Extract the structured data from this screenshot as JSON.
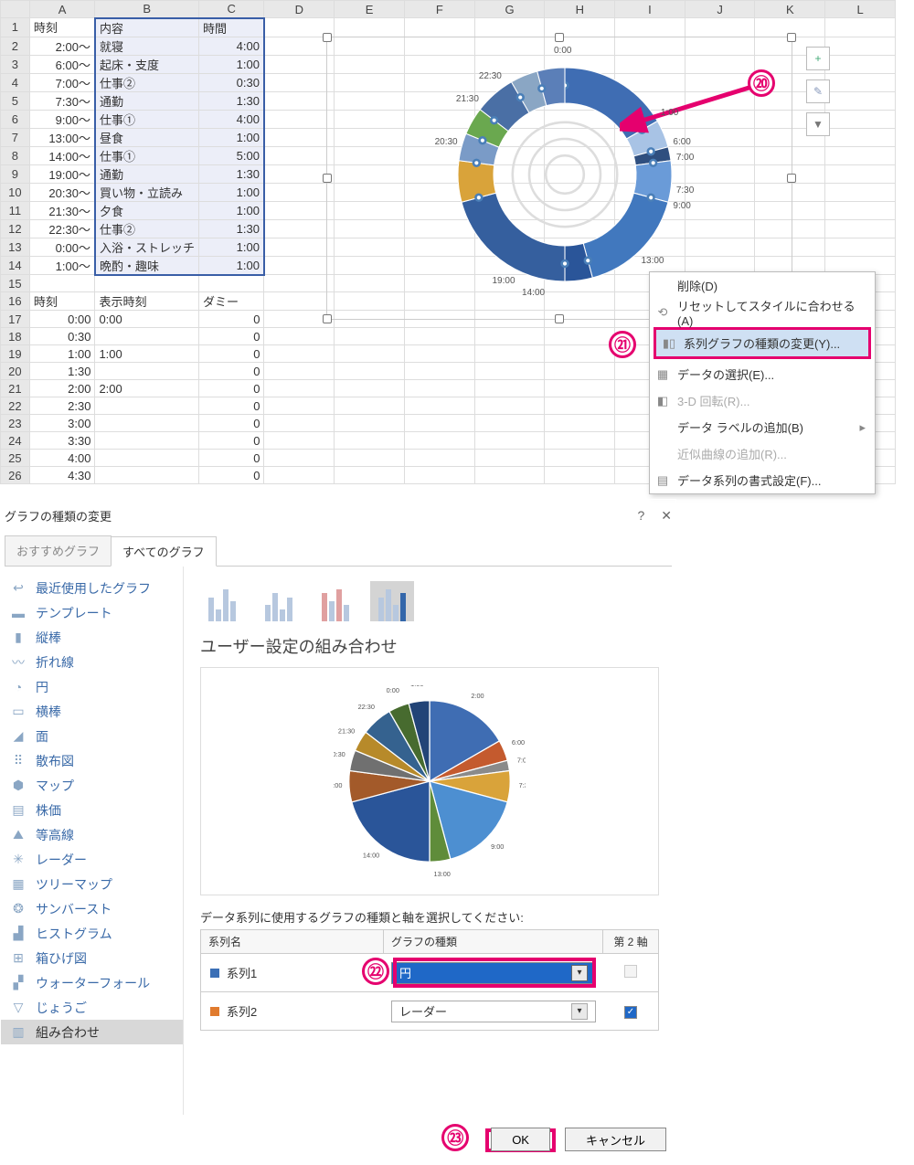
{
  "cols": [
    "A",
    "B",
    "C",
    "D",
    "E",
    "F",
    "G",
    "H",
    "I",
    "J",
    "K",
    "L"
  ],
  "headers": {
    "A": "時刻",
    "B": "内容",
    "C": "時間"
  },
  "rows1": [
    [
      "2:00～",
      "就寝",
      "4:00"
    ],
    [
      "6:00～",
      "起床・支度",
      "1:00"
    ],
    [
      "7:00～",
      "仕事②",
      "0:30"
    ],
    [
      "7:30～",
      "通勤",
      "1:30"
    ],
    [
      "9:00～",
      "仕事①",
      "4:00"
    ],
    [
      "13:00～",
      "昼食",
      "1:00"
    ],
    [
      "14:00～",
      "仕事①",
      "5:00"
    ],
    [
      "19:00～",
      "通勤",
      "1:30"
    ],
    [
      "20:30～",
      "買い物・立読み",
      "1:00"
    ],
    [
      "21:30～",
      "夕食",
      "1:00"
    ],
    [
      "22:30～",
      "仕事②",
      "1:30"
    ],
    [
      "0:00～",
      "入浴・ストレッチ",
      "1:00"
    ],
    [
      "1:00～",
      "晩酌・趣味",
      "1:00"
    ]
  ],
  "headers2": {
    "A": "時刻",
    "B": "表示時刻",
    "C": "ダミー"
  },
  "rows2": [
    [
      "0:00",
      "0:00",
      "0"
    ],
    [
      "0:30",
      "",
      "0"
    ],
    [
      "1:00",
      "1:00",
      "0"
    ],
    [
      "1:30",
      "",
      "0"
    ],
    [
      "2:00",
      "2:00",
      "0"
    ],
    [
      "2:30",
      "",
      "0"
    ],
    [
      "3:00",
      "",
      "0"
    ],
    [
      "3:30",
      "",
      "0"
    ],
    [
      "4:00",
      "",
      "0"
    ],
    [
      "4:30",
      "",
      "0"
    ]
  ],
  "chartLabels": [
    "0:00",
    "1:00",
    "6:00",
    "7:00",
    "7:30",
    "9:00",
    "13:00",
    "14:00",
    "19:00",
    "20:30",
    "21:30",
    "22:30"
  ],
  "chart_data": {
    "type": "pie",
    "title": "",
    "categories": [
      "2:00～",
      "6:00～",
      "7:00～",
      "7:30～",
      "9:00～",
      "13:00～",
      "14:00～",
      "19:00～",
      "20:30～",
      "21:30～",
      "22:30～",
      "0:00～",
      "1:00～"
    ],
    "values": [
      4,
      1,
      0.5,
      1.5,
      4,
      1,
      5,
      1.5,
      1,
      1,
      1.5,
      1,
      1
    ]
  },
  "ctx": {
    "delete": "削除(D)",
    "reset": "リセットしてスタイルに合わせる(A)",
    "change": "系列グラフの種類の変更(Y)...",
    "data": "データの選択(E)...",
    "rot": "3-D 回転(R)...",
    "label": "データ ラベルの追加(B)",
    "trend": "近似曲線の追加(R)...",
    "fmt": "データ系列の書式設定(F)..."
  },
  "dlg": {
    "title": "グラフの種類の変更",
    "tab1": "おすすめグラフ",
    "tab2": "すべてのグラフ",
    "types": [
      "最近使用したグラフ",
      "テンプレート",
      "縦棒",
      "折れ線",
      "円",
      "横棒",
      "面",
      "散布図",
      "マップ",
      "株価",
      "等高線",
      "レーダー",
      "ツリーマップ",
      "サンバースト",
      "ヒストグラム",
      "箱ひげ図",
      "ウォーターフォール",
      "じょうご",
      "組み合わせ"
    ],
    "h3": "ユーザー設定の組み合わせ",
    "seriesCaption": "データ系列に使用するグラフの種類と軸を選択してください:",
    "hdr": {
      "a": "系列名",
      "b": "グラフの種類",
      "c": "第 2 軸"
    },
    "s1": {
      "name": "系列1",
      "type": "円"
    },
    "s2": {
      "name": "系列2",
      "type": "レーダー"
    },
    "ok": "OK",
    "cancel": "キャンセル"
  },
  "annot": {
    "20": "⑳",
    "21": "㉑",
    "22": "㉒",
    "23": "㉓"
  },
  "ic": {
    "plus": "+",
    "brush": "✎",
    "filter": "▼",
    "help": "?",
    "close": "✕",
    "check": "✓",
    "chev": "▸",
    "dd": "▾"
  }
}
